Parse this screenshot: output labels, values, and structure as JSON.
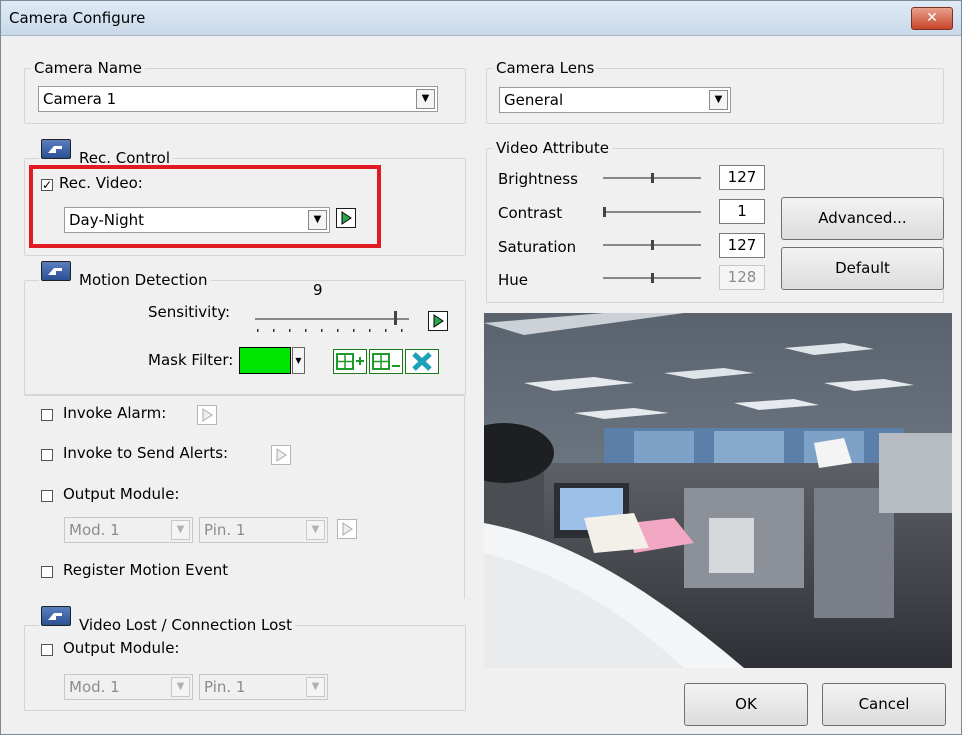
{
  "window": {
    "title": "Camera Configure",
    "close_glyph": "✕"
  },
  "camera_name": {
    "legend": "Camera Name",
    "value": "Camera 1"
  },
  "camera_lens": {
    "legend": "Camera Lens",
    "value": "General"
  },
  "rec_control": {
    "legend": "Rec. Control",
    "rec_video_label": "Rec. Video:",
    "rec_video_checked": true,
    "mode": "Day-Night"
  },
  "motion_detection": {
    "legend": "Motion Detection",
    "sensitivity_label": "Sensitivity:",
    "sensitivity_value": "9",
    "sensitivity_level": 0.9,
    "mask_filter_label": "Mask Filter:",
    "mask_color": "#00e600"
  },
  "alarm": {
    "invoke_alarm": "Invoke Alarm:",
    "invoke_alerts": "Invoke to Send Alerts:",
    "output_module": "Output Module:",
    "mod": "Mod. 1",
    "pin": "Pin. 1",
    "register_motion": "Register Motion Event"
  },
  "video_lost": {
    "legend": "Video Lost / Connection Lost",
    "output_module": "Output Module:",
    "mod": "Mod. 1",
    "pin": "Pin. 1"
  },
  "video_attribute": {
    "legend": "Video Attribute",
    "brightness_label": "Brightness",
    "brightness": "127",
    "contrast_label": "Contrast",
    "contrast": "1",
    "saturation_label": "Saturation",
    "saturation": "127",
    "hue_label": "Hue",
    "hue": "128"
  },
  "buttons": {
    "advanced": "Advanced...",
    "default": "Default",
    "ok": "OK",
    "cancel": "Cancel"
  },
  "colors": {
    "highlight": "#e01b24",
    "mask": "#00e600"
  }
}
